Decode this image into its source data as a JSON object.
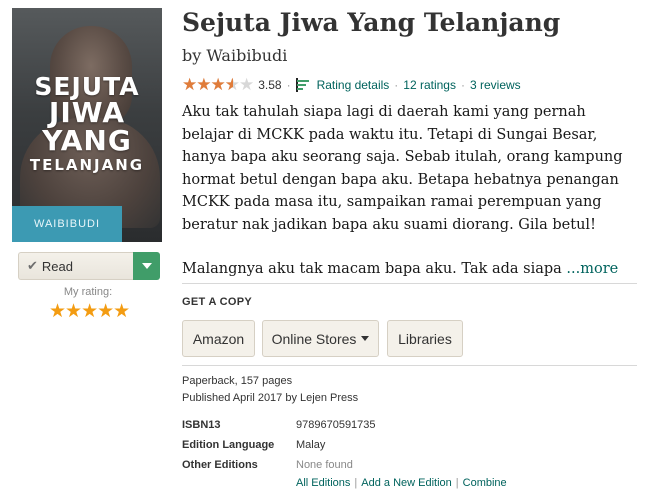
{
  "book": {
    "title": "Sejuta Jiwa Yang Telanjang",
    "by": "by",
    "author": "Waibibudi",
    "cover": {
      "title_lines": [
        "SEJUTA",
        "JIWA",
        "YANG",
        "TELANJANG"
      ],
      "author_band": "WAIBIBUDI",
      "band_color": "#3c9ab3"
    }
  },
  "rating": {
    "average": "3.58",
    "average_value": 3.58,
    "stars_max": 5,
    "details_label": "Rating details",
    "ratings_label": "12 ratings",
    "reviews_label": "3 reviews",
    "separator": "·",
    "star_color": "#e07c3a"
  },
  "description": {
    "paragraph1": "Aku tak tahulah siapa lagi di daerah kami yang pernah belajar di MCKK pada waktu itu. Tetapi di Sungai Besar, hanya bapa aku seorang saja. Sebab itulah, orang kampung hormat betul dengan bapa aku. Betapa hebatnya penangan MCKK pada masa itu, sampaikan ramai perempuan yang beratur nak jadikan bapa aku suami diorang. Gila betul!",
    "paragraph2": "Malangnya aku tak macam bapa aku. Tak ada siapa",
    "more_label": "...more"
  },
  "shelf": {
    "status_label": "Read",
    "check_icon": "check-icon",
    "button_color": "#409d69",
    "my_rating_label": "My rating:",
    "my_rating_value": 5,
    "my_rating_stars": "★★★★★"
  },
  "get_copy": {
    "heading": "GET A COPY",
    "buttons": {
      "amazon": "Amazon",
      "online_stores": "Online Stores",
      "libraries": "Libraries"
    }
  },
  "edition": {
    "format": "Paperback, 157 pages",
    "published": "Published April 2017 by Lejen Press",
    "fields": [
      {
        "key": "ISBN13",
        "value": "9789670591735"
      },
      {
        "key": "Edition Language",
        "value": "Malay"
      },
      {
        "key": "Other Editions",
        "value": "None found"
      }
    ],
    "links": {
      "all": "All Editions",
      "add": "Add a New Edition",
      "combine": "Combine",
      "separator": "|"
    }
  },
  "colors": {
    "link": "#00635d",
    "star_orange": "#f39c12",
    "beige_button": "#f4f1ea"
  }
}
